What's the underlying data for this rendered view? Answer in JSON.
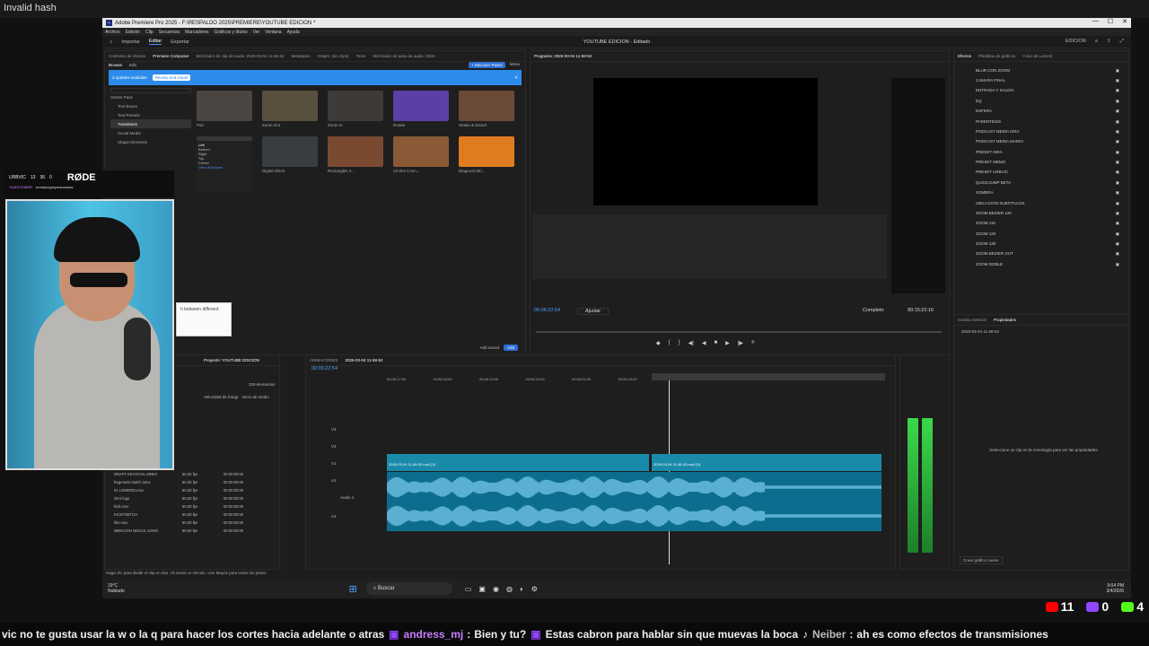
{
  "topbar": {
    "text": "Invalid hash"
  },
  "window": {
    "title": "Adobe Premiere Pro 2025 - F:\\RESPALDO 2025\\PREMIERE\\YOUTUBE EDICION *",
    "controls": [
      "—",
      "☐",
      "✕"
    ]
  },
  "menu": [
    "Archivo",
    "Edición",
    "Clip",
    "Secuencia",
    "Marcadores",
    "Gráficos y títulos",
    "Ver",
    "Ventana",
    "Ayuda"
  ],
  "workspace": {
    "tabs": [
      "Importar",
      "Editar",
      "Exportar"
    ],
    "active": "Editar",
    "project_name": "YOUTUBE EDICION - Editado",
    "right_label": "EDICION"
  },
  "source_panel": {
    "tabs": [
      "Controles de efectos",
      "Premiere Composer",
      "Mezclador de clip de audio: 2026-03-04 11-58-52",
      "Metadatos",
      "Origen: (sin clips)",
      "Texto",
      "Mezclador de pista de audio: 2026-"
    ],
    "subtabs": [
      "Browse",
      "Edit"
    ],
    "discover_label": "+ Discover Packs",
    "menu_label": "Menu",
    "banner_text": "2 updates available",
    "banner_button": "Review and install",
    "tree": [
      "Starter Pack",
      "Text Boxes",
      "Text Presets",
      "Transitions",
      "Social Media",
      "Shape Elements"
    ],
    "thumbs": [
      {
        "label": "Pan",
        "color": "#4a4540"
      },
      {
        "label": "Zoom Out",
        "color": "#5a5040"
      },
      {
        "label": "Zoom In",
        "color": "#3d3a38"
      },
      {
        "label": "Rotate",
        "color": "#5b3ea6"
      },
      {
        "label": "Shake & Distort",
        "color": "#6b4a38"
      },
      {
        "label": "Fade to Black",
        "color": "#383838"
      },
      {
        "label": "Digital Glitch",
        "color": "#3a3d40"
      },
      {
        "label": "Rectangles 2...",
        "color": "#7a4a30"
      },
      {
        "label": "Circles Conn...",
        "color": "#8a5a36"
      },
      {
        "label": "Diagonal Stri...",
        "color": "#e07b20"
      }
    ],
    "dropdown": [
      "Left",
      "Bottom",
      "Right",
      "Top",
      "Center"
    ],
    "view_all": "View all 8 sizes",
    "add_sound": "Add sound",
    "add_button": "Add"
  },
  "program": {
    "tab": "Programa: 2026-03-04 11-58-52",
    "timecode": "00:06:22:54",
    "fit": "Ajustar",
    "quality": "Completo",
    "duration": "00:15:22:16"
  },
  "project": {
    "tabs": [
      "Proyecto: YOUTUBE EDICION"
    ],
    "count": "230 elementos",
    "headers": [
      "Velocidad de fotogr",
      "Inicio de medio"
    ],
    "rows": [
      {
        "name": "DRAFT KEVSTAN URBVI",
        "fps": "60,00 fps",
        "start": "00:00:00:00"
      },
      {
        "name": "fragmento twitch intro.",
        "fps": "60,00 fps",
        "start": "00:00:00:00"
      },
      {
        "name": "IG LOWERD.mov",
        "fps": "60,00 fps",
        "start": "00:00:00:00"
      },
      {
        "name": "intro logo",
        "fps": "60,00 fps",
        "start": "00:00:00:00"
      },
      {
        "name": "kick.mov",
        "fps": "60,00 fps",
        "start": "00:00:00:00"
      },
      {
        "name": "KICKTWITCH",
        "fps": "60,00 fps",
        "start": "00:00:00:00"
      },
      {
        "name": "like.mov",
        "fps": "60,00 fps",
        "start": "00:00:00:00"
      },
      {
        "name": "MENCION NEXUS JUNIO",
        "fps": "60,00 fps",
        "start": "00:00:00:00"
      }
    ]
  },
  "timeline": {
    "tabs": [
      "ANIMACIONES",
      "2026-03-04 11-58-52"
    ],
    "timecode": "00:06:22:54",
    "ruler": [
      "00:06:17:00",
      "00:06:18:00",
      "00:06:19:00",
      "00:06:20:00",
      "00:06:21:00",
      "00:06:22:00",
      "00:06:23:00",
      "00:06:24:00",
      "00:06:25:00",
      "00:06:26:00",
      "00:06:27:00"
    ],
    "tracks": [
      "V3",
      "V2",
      "V1",
      "A1",
      "A2"
    ],
    "clip_v1": "2026-03-04 11-58-52.mp4 [V]",
    "clip_v2": "2026-03-04 11-58-52.mp4 [V]",
    "audio_label": "Audio 1",
    "hint": "Haga clic para dividir el clip en dos. Alt anula un vínculo. Use Mayús para todos los pistes."
  },
  "effects": {
    "tabs": [
      "Efectos",
      "Plantillas de gráficos",
      "Color de Lumetri"
    ],
    "items": [
      "BLUR CON ZOOM",
      "CAMARA FINAL",
      "ENTRADA Y SALIDA",
      "EQ",
      "ESFERA",
      "PARENTESIS",
      "PODCAST MEDIA ISRA",
      "PODCAST MEDIA MARIO",
      "PRESET ISRA",
      "PRESET MEMO",
      "PRESET URBVIC",
      "QUICKJUMP BETA",
      "SOMBRA",
      "UBICACION SUBTITULOS",
      "ZOOM BEZIER 120",
      "ZOOM 110",
      "ZOOM 120",
      "ZOOM 130",
      "ZOOM BEZIER OUT",
      "ZOOM DOBLE"
    ]
  },
  "properties": {
    "tabs": [
      "Sonido esencial",
      "Propiedades"
    ],
    "clip": "2026-03-04 11-58-52",
    "empty_msg": "Seleccione un clip en la cronología para ver las propiedades.",
    "new_graphic": "Crear gráfico nuevo"
  },
  "taskbar": {
    "weather_temp": "19°C",
    "weather_desc": "Nublado",
    "search": "Buscar",
    "time": "9:04 PM",
    "date": "3/4/2026"
  },
  "overlay": {
    "channel": "URBVIC",
    "counts": [
      "13",
      "36",
      "0"
    ],
    "brand": "RØDE",
    "subscriber_label": "SUBSCRIBER",
    "subscriber_name": "entrejuegosymanzanas",
    "popup_text": "h between different"
  },
  "chat": {
    "msg1": "vic no te gusta usar la w o la q para hacer los cortes hacia adelante o atras",
    "user2": "andress_mj",
    "msg2": "Bien y tu?",
    "msg3": "Estas cabron para hablar sin que muevas la boca",
    "user4": "Neiber",
    "msg4": "ah es como efectos de transmisiones"
  },
  "stats": {
    "youtube": "11",
    "twitch": "0",
    "kick": "4",
    "colors": {
      "youtube": "#ff0000",
      "twitch": "#9146ff",
      "kick": "#53fc18"
    }
  }
}
